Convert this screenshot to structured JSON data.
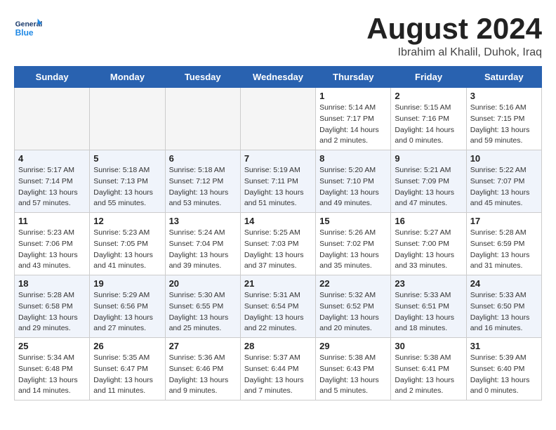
{
  "header": {
    "logo_general": "General",
    "logo_blue": "Blue",
    "month_year": "August 2024",
    "location": "Ibrahim al Khalil, Duhok, Iraq"
  },
  "weekdays": [
    "Sunday",
    "Monday",
    "Tuesday",
    "Wednesday",
    "Thursday",
    "Friday",
    "Saturday"
  ],
  "weeks": [
    [
      {
        "day": "",
        "empty": true
      },
      {
        "day": "",
        "empty": true
      },
      {
        "day": "",
        "empty": true
      },
      {
        "day": "",
        "empty": true
      },
      {
        "day": "1",
        "sunrise": "5:14 AM",
        "sunset": "7:17 PM",
        "daylight": "14 hours and 2 minutes."
      },
      {
        "day": "2",
        "sunrise": "5:15 AM",
        "sunset": "7:16 PM",
        "daylight": "14 hours and 0 minutes."
      },
      {
        "day": "3",
        "sunrise": "5:16 AM",
        "sunset": "7:15 PM",
        "daylight": "13 hours and 59 minutes."
      }
    ],
    [
      {
        "day": "4",
        "sunrise": "5:17 AM",
        "sunset": "7:14 PM",
        "daylight": "13 hours and 57 minutes."
      },
      {
        "day": "5",
        "sunrise": "5:18 AM",
        "sunset": "7:13 PM",
        "daylight": "13 hours and 55 minutes."
      },
      {
        "day": "6",
        "sunrise": "5:18 AM",
        "sunset": "7:12 PM",
        "daylight": "13 hours and 53 minutes."
      },
      {
        "day": "7",
        "sunrise": "5:19 AM",
        "sunset": "7:11 PM",
        "daylight": "13 hours and 51 minutes."
      },
      {
        "day": "8",
        "sunrise": "5:20 AM",
        "sunset": "7:10 PM",
        "daylight": "13 hours and 49 minutes."
      },
      {
        "day": "9",
        "sunrise": "5:21 AM",
        "sunset": "7:09 PM",
        "daylight": "13 hours and 47 minutes."
      },
      {
        "day": "10",
        "sunrise": "5:22 AM",
        "sunset": "7:07 PM",
        "daylight": "13 hours and 45 minutes."
      }
    ],
    [
      {
        "day": "11",
        "sunrise": "5:23 AM",
        "sunset": "7:06 PM",
        "daylight": "13 hours and 43 minutes."
      },
      {
        "day": "12",
        "sunrise": "5:23 AM",
        "sunset": "7:05 PM",
        "daylight": "13 hours and 41 minutes."
      },
      {
        "day": "13",
        "sunrise": "5:24 AM",
        "sunset": "7:04 PM",
        "daylight": "13 hours and 39 minutes."
      },
      {
        "day": "14",
        "sunrise": "5:25 AM",
        "sunset": "7:03 PM",
        "daylight": "13 hours and 37 minutes."
      },
      {
        "day": "15",
        "sunrise": "5:26 AM",
        "sunset": "7:02 PM",
        "daylight": "13 hours and 35 minutes."
      },
      {
        "day": "16",
        "sunrise": "5:27 AM",
        "sunset": "7:00 PM",
        "daylight": "13 hours and 33 minutes."
      },
      {
        "day": "17",
        "sunrise": "5:28 AM",
        "sunset": "6:59 PM",
        "daylight": "13 hours and 31 minutes."
      }
    ],
    [
      {
        "day": "18",
        "sunrise": "5:28 AM",
        "sunset": "6:58 PM",
        "daylight": "13 hours and 29 minutes."
      },
      {
        "day": "19",
        "sunrise": "5:29 AM",
        "sunset": "6:56 PM",
        "daylight": "13 hours and 27 minutes."
      },
      {
        "day": "20",
        "sunrise": "5:30 AM",
        "sunset": "6:55 PM",
        "daylight": "13 hours and 25 minutes."
      },
      {
        "day": "21",
        "sunrise": "5:31 AM",
        "sunset": "6:54 PM",
        "daylight": "13 hours and 22 minutes."
      },
      {
        "day": "22",
        "sunrise": "5:32 AM",
        "sunset": "6:52 PM",
        "daylight": "13 hours and 20 minutes."
      },
      {
        "day": "23",
        "sunrise": "5:33 AM",
        "sunset": "6:51 PM",
        "daylight": "13 hours and 18 minutes."
      },
      {
        "day": "24",
        "sunrise": "5:33 AM",
        "sunset": "6:50 PM",
        "daylight": "13 hours and 16 minutes."
      }
    ],
    [
      {
        "day": "25",
        "sunrise": "5:34 AM",
        "sunset": "6:48 PM",
        "daylight": "13 hours and 14 minutes."
      },
      {
        "day": "26",
        "sunrise": "5:35 AM",
        "sunset": "6:47 PM",
        "daylight": "13 hours and 11 minutes."
      },
      {
        "day": "27",
        "sunrise": "5:36 AM",
        "sunset": "6:46 PM",
        "daylight": "13 hours and 9 minutes."
      },
      {
        "day": "28",
        "sunrise": "5:37 AM",
        "sunset": "6:44 PM",
        "daylight": "13 hours and 7 minutes."
      },
      {
        "day": "29",
        "sunrise": "5:38 AM",
        "sunset": "6:43 PM",
        "daylight": "13 hours and 5 minutes."
      },
      {
        "day": "30",
        "sunrise": "5:38 AM",
        "sunset": "6:41 PM",
        "daylight": "13 hours and 2 minutes."
      },
      {
        "day": "31",
        "sunrise": "5:39 AM",
        "sunset": "6:40 PM",
        "daylight": "13 hours and 0 minutes."
      }
    ]
  ]
}
